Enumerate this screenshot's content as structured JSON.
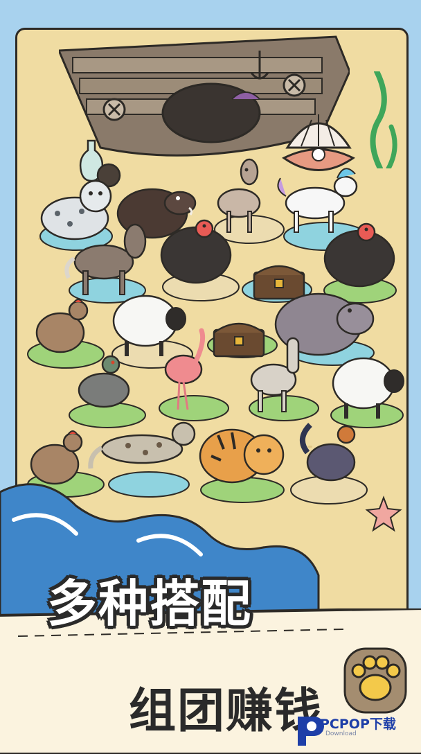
{
  "banner": {
    "title_line1": "多种搭配",
    "title_line2": "组团赚钱"
  },
  "watermark": {
    "brand": "PCPOP下载",
    "subtitle": "Download"
  },
  "board": {
    "animals": [
      "snow-leopard",
      "boar",
      "deer",
      "unicorn",
      "horse",
      "turkey",
      "turkey",
      "treasure-chest",
      "chicken",
      "sheep",
      "hippo",
      "treasure-chest",
      "pigeon",
      "flamingo",
      "alpaca",
      "sheep",
      "chicken",
      "leopard-cat",
      "tiger",
      "rooster"
    ]
  },
  "colors": {
    "sky": "#a8d2ee",
    "sand": "#f0dca2",
    "grass": "#9fd37a",
    "water": "#8fd3df",
    "wave": "#3f86c9",
    "banner_bg": "#fbf3df",
    "accent_text": "#2a2a2a"
  }
}
